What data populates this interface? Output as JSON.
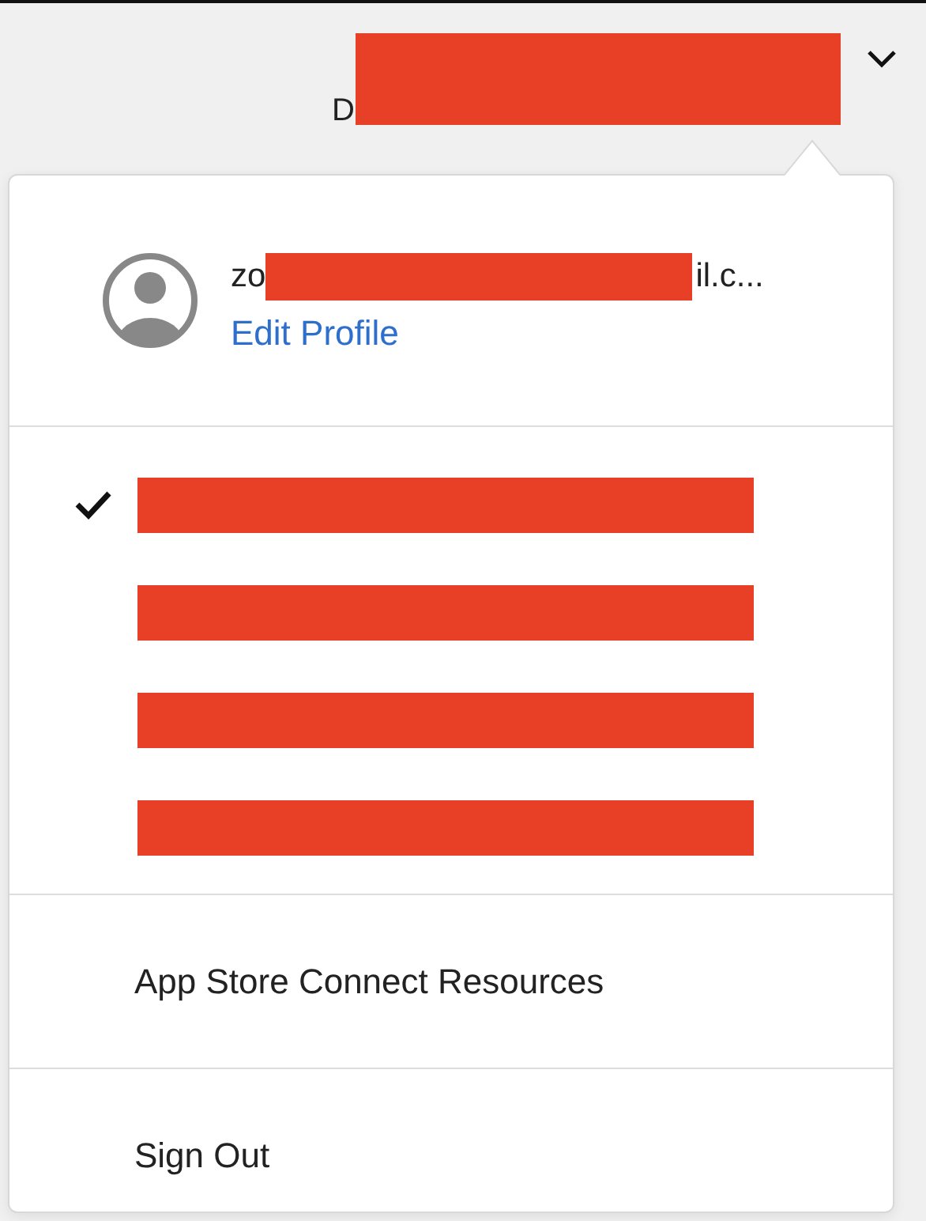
{
  "header": {
    "account_visible_text": "D",
    "redacted": true
  },
  "profile": {
    "email_visible_start": "zo",
    "email_visible_end": "il.c...",
    "email_redacted": true,
    "edit_link": "Edit Profile"
  },
  "teams": [
    {
      "selected": true,
      "redacted": true
    },
    {
      "selected": false,
      "redacted": true
    },
    {
      "selected": false,
      "redacted": true
    },
    {
      "selected": false,
      "redacted": true
    }
  ],
  "menu_items": [
    "App Store Connect Resources",
    "Sign Out"
  ]
}
